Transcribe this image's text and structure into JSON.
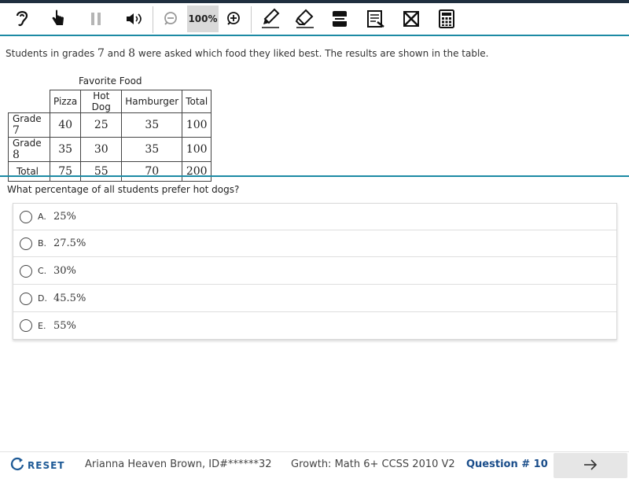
{
  "toolbar": {
    "zoom_label": "100%",
    "icons": [
      "ear-icon",
      "hand-pointer-icon",
      "pause-icon",
      "speaker-icon",
      "zoom-out-icon",
      "zoom-in-icon",
      "highlighter-icon",
      "eraser-icon",
      "line-reader-icon",
      "notepad-icon",
      "eliminate-answer-icon",
      "calculator-icon"
    ]
  },
  "stem": {
    "part1": "Students in grades ",
    "grade_a": "7",
    "part2": " and ",
    "grade_b": "8",
    "part3": " were asked which food they liked best. The results are shown in the table."
  },
  "table": {
    "caption": "Favorite Food",
    "headers": [
      "Pizza",
      "Hot Dog",
      "Hamburger",
      "Total"
    ],
    "rows": [
      {
        "label_prefix": "Grade ",
        "label_num": "7",
        "cells": [
          "40",
          "25",
          "35",
          "100"
        ]
      },
      {
        "label_prefix": "Grade ",
        "label_num": "8",
        "cells": [
          "35",
          "30",
          "35",
          "100"
        ]
      },
      {
        "label_prefix": "Total",
        "label_num": "",
        "cells": [
          "75",
          "55",
          "70",
          "200"
        ]
      }
    ]
  },
  "question": "What percentage of all students prefer hot dogs?",
  "choices": [
    {
      "letter": "A.",
      "text": "25%"
    },
    {
      "letter": "B.",
      "text": "27.5%"
    },
    {
      "letter": "C.",
      "text": "30%"
    },
    {
      "letter": "D.",
      "text": "45.5%"
    },
    {
      "letter": "E.",
      "text": "55%"
    }
  ],
  "footer": {
    "reset_label": "RESET",
    "student": "Arianna Heaven Brown, ID#******32",
    "test": "Growth: Math 6+ CCSS 2010 V2",
    "question_number": "Question # 10",
    "next_icon": "arrow-right-icon"
  },
  "colors": {
    "accent_teal": "#1c8aa4",
    "brand_blue": "#1e5a96",
    "top_bar": "#1f2f3f"
  }
}
